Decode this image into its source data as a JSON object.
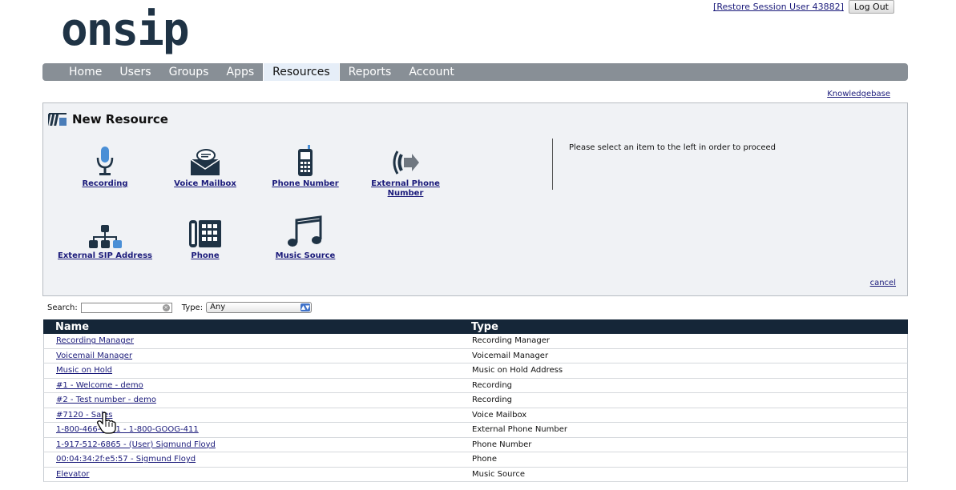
{
  "header": {
    "logo_text": "onsip",
    "restore_link": "[Restore Session User 43882]",
    "logout_label": "Log Out"
  },
  "nav": {
    "items": [
      "Home",
      "Users",
      "Groups",
      "Apps",
      "Resources",
      "Reports",
      "Account"
    ],
    "active": "Resources"
  },
  "knowledgebase_label": "Knowledgebase",
  "panel": {
    "title": "New Resource",
    "items": [
      {
        "label": "Recording",
        "icon": "microphone-icon"
      },
      {
        "label": "Voice Mailbox",
        "icon": "envelope-icon"
      },
      {
        "label": "Phone Number",
        "icon": "mobile-phone-icon"
      },
      {
        "label": "External Phone Number",
        "label_line1": "External Phone",
        "label_line2": "Number",
        "icon": "external-phone-icon"
      },
      {
        "label": "External SIP Address",
        "icon": "network-icon"
      },
      {
        "label": "Phone",
        "icon": "desk-phone-icon"
      },
      {
        "label": "Music Source",
        "icon": "music-note-icon"
      }
    ],
    "hint": "Please select an item to the left in order to proceed",
    "cancel_label": "cancel"
  },
  "filters": {
    "search_label": "Search:",
    "search_value": "",
    "type_label": "Type:",
    "type_selected": "Any"
  },
  "table": {
    "headers": [
      "Name",
      "Type"
    ],
    "rows": [
      {
        "name": "Recording Manager",
        "type": "Recording Manager"
      },
      {
        "name": "Voicemail Manager",
        "type": "Voicemail Manager"
      },
      {
        "name": "Music on Hold",
        "type": "Music on Hold Address"
      },
      {
        "name": "#1 - Welcome - demo",
        "type": "Recording"
      },
      {
        "name": "#2 - Test number - demo",
        "type": "Recording"
      },
      {
        "name": "#7120 - Sales",
        "type": "Voice Mailbox"
      },
      {
        "name": "1-800-466-4411 - 1-800-GOOG-411",
        "type": "External Phone Number"
      },
      {
        "name": "1-917-512-6865 - (User) Sigmund Floyd",
        "type": "Phone Number"
      },
      {
        "name": "00:04:34:2f:e5:57 - Sigmund Floyd",
        "type": "Phone"
      },
      {
        "name": "Elevator",
        "type": "Music Source"
      }
    ]
  },
  "colors": {
    "nav_bg": "#888f96",
    "table_header_bg": "#152638",
    "link": "#1a1a7a",
    "logo": "#1f3345"
  }
}
